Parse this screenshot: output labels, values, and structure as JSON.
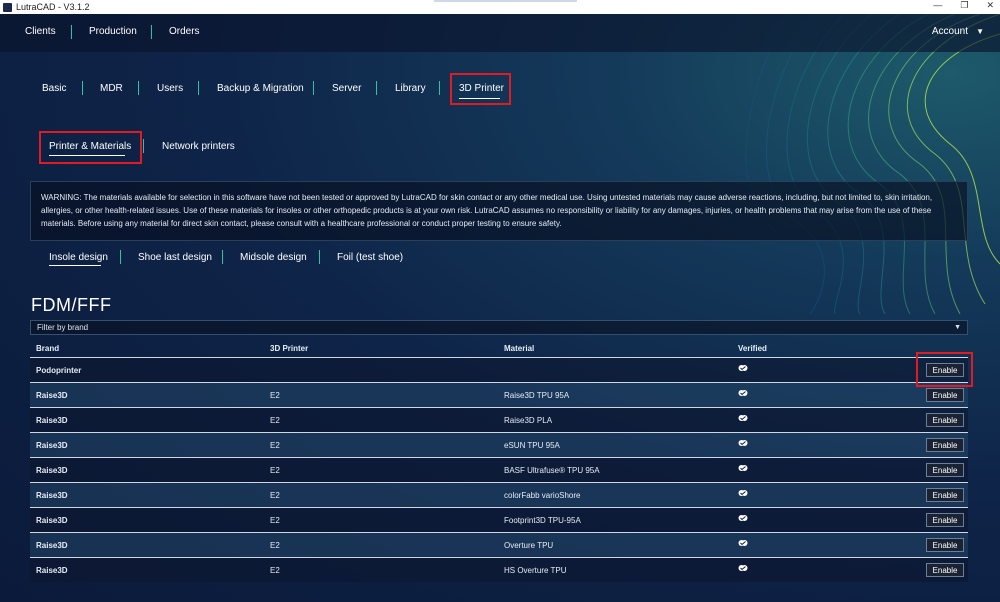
{
  "window": {
    "title": "LutraCAD - V3.1.2",
    "buttons": [
      "—",
      "❐",
      "✕"
    ]
  },
  "topnav": {
    "items": [
      "Clients",
      "Production",
      "Orders"
    ],
    "account": "Account"
  },
  "settings_tabs": [
    "Basic",
    "MDR",
    "Users",
    "Backup & Migration",
    "Server",
    "Library",
    "3D Printer"
  ],
  "subtabs": [
    "Printer & Materials",
    "Network printers"
  ],
  "warning": "WARNING: The materials available for selection in this software have not been tested or approved by LutraCAD for skin contact or any other medical use. Using untested materials may cause adverse reactions, including, but not limited to, skin irritation, allergies, or other health-related issues. Use of these materials for insoles or other orthopedic products is at your own risk. LutraCAD assumes no responsibility or liability for any damages, injuries, or health problems that may arise from the use of these materials. Before using any material for direct skin contact, please consult with a healthcare professional or conduct proper testing to ensure safety.",
  "design_tabs": [
    "Insole design",
    "Shoe last design",
    "Midsole design",
    "Foil (test shoe)"
  ],
  "section_title": "FDM/FFF",
  "filter": {
    "placeholder": "Filter by brand"
  },
  "table": {
    "headers": [
      "Brand",
      "3D Printer",
      "Material",
      "Verified"
    ],
    "rows": [
      {
        "brand": "Podoprinter",
        "printer": "",
        "material": "",
        "action": "Enable"
      },
      {
        "brand": "Raise3D",
        "printer": "E2",
        "material": "Raise3D TPU 95A",
        "action": "Enable"
      },
      {
        "brand": "Raise3D",
        "printer": "E2",
        "material": "Raise3D PLA",
        "action": "Enable"
      },
      {
        "brand": "Raise3D",
        "printer": "E2",
        "material": "eSUN TPU 95A",
        "action": "Enable"
      },
      {
        "brand": "Raise3D",
        "printer": "E2",
        "material": "BASF Ultrafuse® TPU 95A",
        "action": "Enable"
      },
      {
        "brand": "Raise3D",
        "printer": "E2",
        "material": "colorFabb varioShore",
        "action": "Enable"
      },
      {
        "brand": "Raise3D",
        "printer": "E2",
        "material": "Footprint3D TPU-95A",
        "action": "Enable"
      },
      {
        "brand": "Raise3D",
        "printer": "E2",
        "material": "Overture TPU",
        "action": "Enable"
      },
      {
        "brand": "Raise3D",
        "printer": "E2",
        "material": "HS Overture TPU",
        "action": "Enable"
      }
    ]
  },
  "colors": {
    "accent": "#2cc4a8",
    "highlight": "#e01b24"
  }
}
